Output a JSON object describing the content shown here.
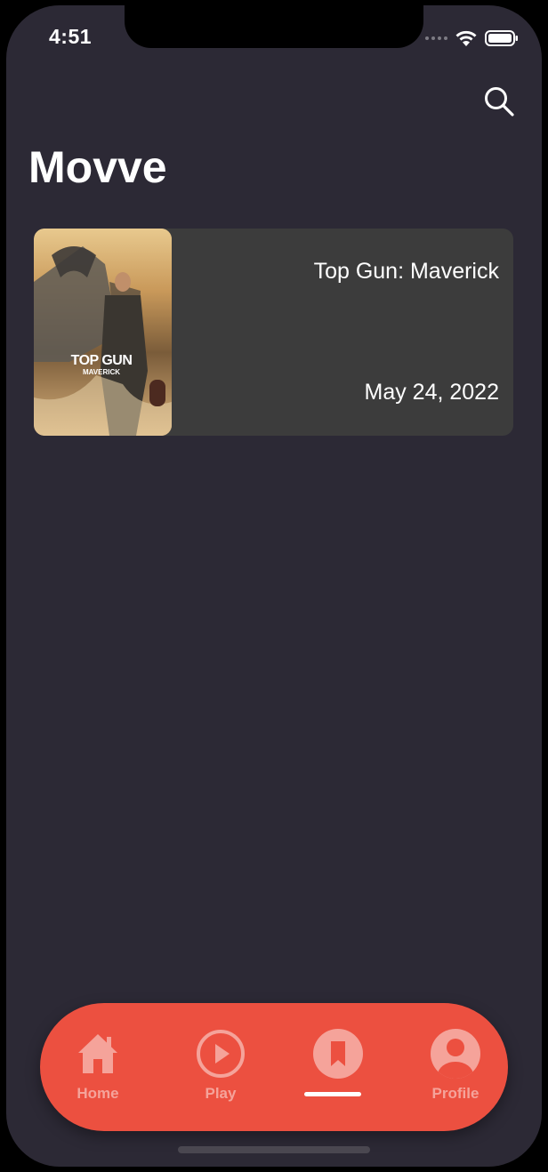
{
  "status_bar": {
    "time": "4:51"
  },
  "header": {
    "title": "Movve",
    "search_icon": "search-icon"
  },
  "movies": [
    {
      "title": "Top Gun: Maverick",
      "release_date": "May 24, 2022",
      "poster_logo_line1": "TOP GUN",
      "poster_logo_line2": "MAVERICK"
    }
  ],
  "tabbar": {
    "active_index": 2,
    "tabs": [
      {
        "label": "Home",
        "icon": "home-icon"
      },
      {
        "label": "Play",
        "icon": "play-icon"
      },
      {
        "label": "",
        "icon": "bookmark-icon"
      },
      {
        "label": "Profile",
        "icon": "profile-icon"
      }
    ]
  },
  "colors": {
    "background": "#2c2935",
    "card": "#3c3c3c",
    "tabbar": "#ec5040",
    "tab_inactive": "#f5a39a",
    "tab_indicator": "#ffffff"
  }
}
